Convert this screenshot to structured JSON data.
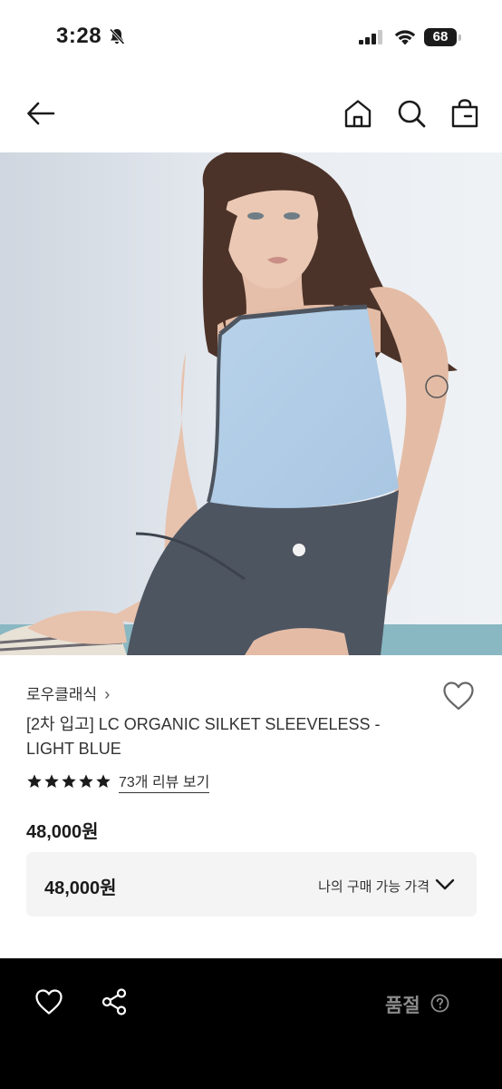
{
  "status_bar": {
    "time": "3:28",
    "battery": "68",
    "icons": [
      "bell-slash-icon",
      "signal-icon",
      "wifi-icon",
      "battery-icon"
    ]
  },
  "nav": {
    "icons": [
      "back-arrow-icon",
      "home-icon",
      "search-icon",
      "shopping-bag-icon"
    ]
  },
  "product": {
    "image_alt": "",
    "brand": "로우클래식",
    "brand_chevron": "›",
    "title": "[2차 입고] LC ORGANIC SILKET SLEEVELESS - LIGHT BLUE",
    "rating": 5,
    "review_link": "73개 리뷰 보기",
    "price": "48,000원"
  },
  "price_box": {
    "value": "48,000원",
    "label": "나의 구매 가능 가격"
  },
  "bottom_bar": {
    "status_label": "품절",
    "icons": [
      "heart-icon",
      "share-icon",
      "help-icon"
    ]
  },
  "colors": {
    "text": "#1b1b1b",
    "price_box_bg": "#f4f4f4",
    "bottom_bar_bg": "#000000",
    "soldout_gray": "#8b8b8b"
  }
}
